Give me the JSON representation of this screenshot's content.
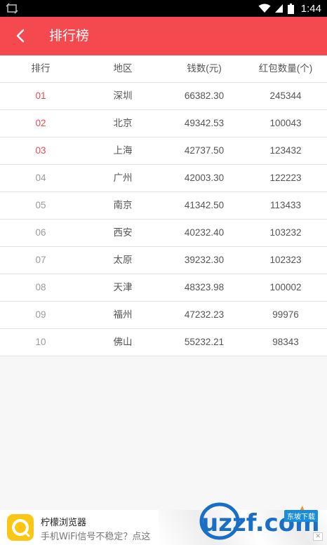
{
  "status_bar": {
    "time": "1:44",
    "icons": [
      "screenshot-icon",
      "wifi-icon",
      "signal-icon",
      "battery-icon"
    ]
  },
  "app_bar": {
    "back_icon": "back-arrow-icon",
    "title": "排行榜",
    "color": "#f44a4f"
  },
  "table": {
    "headers": [
      "排行",
      "地区",
      "钱数(元)",
      "红包数量(个)"
    ],
    "rows": [
      {
        "rank": "01",
        "region": "深圳",
        "amount": "66382.30",
        "count": "245344"
      },
      {
        "rank": "02",
        "region": "北京",
        "amount": "49342.53",
        "count": "100043"
      },
      {
        "rank": "03",
        "region": "上海",
        "amount": "42737.50",
        "count": "123432"
      },
      {
        "rank": "04",
        "region": "广州",
        "amount": "42003.30",
        "count": "122223"
      },
      {
        "rank": "05",
        "region": "南京",
        "amount": "41342.50",
        "count": "113433"
      },
      {
        "rank": "06",
        "region": "西安",
        "amount": "40232.40",
        "count": "103232"
      },
      {
        "rank": "07",
        "region": "太原",
        "amount": "39232.30",
        "count": "102323"
      },
      {
        "rank": "08",
        "region": "天津",
        "amount": "48323.98",
        "count": "100002"
      },
      {
        "rank": "09",
        "region": "福州",
        "amount": "47232.23",
        "count": "99976"
      },
      {
        "rank": "10",
        "region": "佛山",
        "amount": "55232.21",
        "count": "98343"
      }
    ],
    "top_rank_color": "#e94b50"
  },
  "ad_banner": {
    "title": "柠檬浏览器",
    "subtitle": "手机WiFi信号不稳定？点这",
    "logo_icon": "lemon-browser-icon",
    "watermark": "uzzf.com",
    "watermark_badge": "东坡下载"
  }
}
